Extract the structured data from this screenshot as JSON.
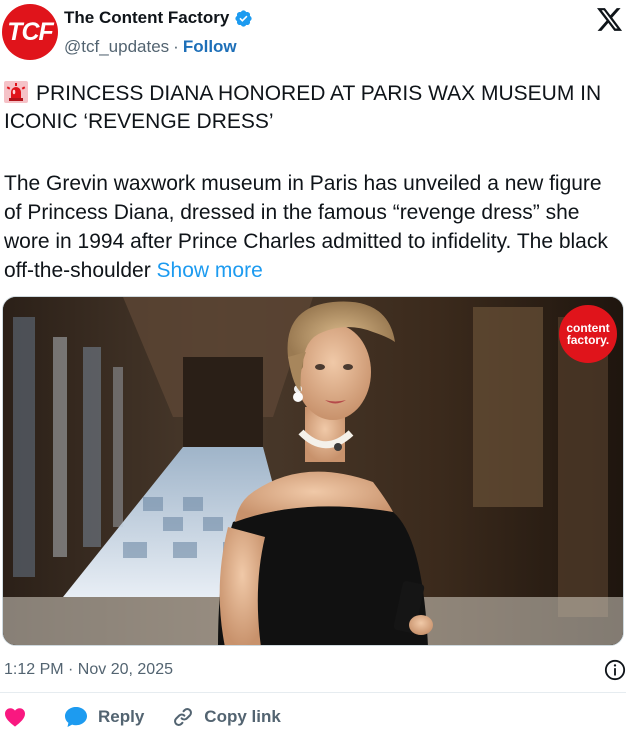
{
  "author": {
    "avatar_text": "TCF",
    "display_name": "The Content Factory",
    "handle": "@tcf_updates",
    "separator": "·",
    "follow_label": "Follow",
    "verified": true
  },
  "post": {
    "headline": "PRINCESS DIANA HONORED AT PARIS WAX MUSEUM IN ICONIC ‘REVENGE DRESS’",
    "body": "The Grevin waxwork museum in Paris has unveiled a new figure of Princess Diana, dressed in the famous “revenge dress” she wore in 1994 after Prince Charles admitted to infidelity. The black off-the-shoulder",
    "show_more_label": "Show more",
    "timestamp": "1:12 PM · Nov 20, 2025"
  },
  "media": {
    "watermark_line1": "content",
    "watermark_line2": "factory."
  },
  "actions": {
    "reply_label": "Reply",
    "copy_link_label": "Copy link"
  },
  "icons": {
    "brand": "x-logo-icon",
    "verified": "verified-badge-icon",
    "siren": "siren-icon",
    "info": "info-icon",
    "like": "heart-icon",
    "reply": "reply-bubble-icon",
    "copy_link": "link-icon"
  },
  "colors": {
    "brand_red": "#e0141b",
    "verified_blue": "#1d9bf0",
    "link_blue": "#1d9bf0",
    "like_pink": "#f91880",
    "muted": "#536471"
  }
}
